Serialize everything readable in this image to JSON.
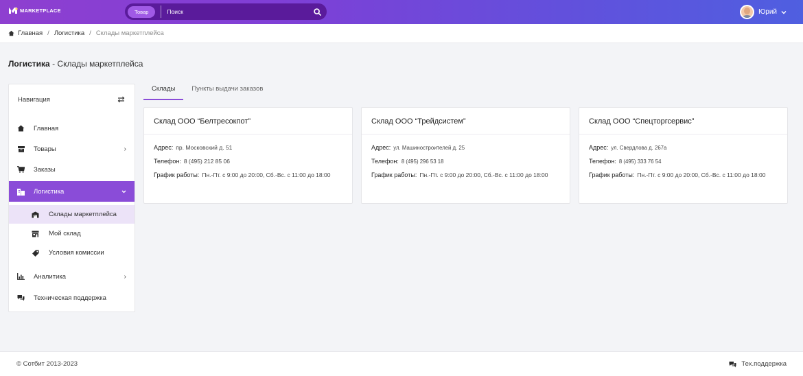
{
  "colors": {
    "accent": "#8a4cd8",
    "accent_light": "#ece3f8",
    "topbar_start": "#8e3fd0",
    "topbar_end": "#4f5fe0"
  },
  "header": {
    "logo_text": "MARKETPLACE",
    "search": {
      "category": "Товар",
      "placeholder": "Поиск"
    },
    "user_name": "Юрий"
  },
  "breadcrumb": {
    "home": "Главная",
    "section": "Логистика",
    "current": "Склады маркетплейса"
  },
  "page_title": {
    "section": "Логистика",
    "separator": " - ",
    "page": "Склады маркетплейса"
  },
  "sidebar": {
    "heading": "Навигация",
    "items": [
      {
        "label": "Главная",
        "icon": "home-icon"
      },
      {
        "label": "Товары",
        "icon": "box-icon"
      },
      {
        "label": "Заказы",
        "icon": "cart-icon"
      },
      {
        "label": "Логистика",
        "icon": "warehouse-icon"
      },
      {
        "label": "Аналитика",
        "icon": "chart-icon"
      },
      {
        "label": "Техническая поддержка",
        "icon": "support-icon"
      }
    ],
    "sub_items": [
      {
        "label": "Склады маркетплейса",
        "icon": "warehouse-icon"
      },
      {
        "label": "Мой склад",
        "icon": "store-icon"
      },
      {
        "label": "Условия комиссии",
        "icon": "tag-icon"
      }
    ]
  },
  "tabs": [
    "Склады",
    "Пункты выдачи заказов"
  ],
  "field_labels": {
    "address": "Адрес:",
    "phone": "Телефон:",
    "schedule": "График работы:"
  },
  "cards": [
    {
      "title": "Склад ООО “Белтресокпот”",
      "address": "пр. Московский д. 51",
      "phone": "8 (495) 212 85 06",
      "schedule": "Пн.-Пт. с 9:00 до 20:00, Сб.-Вс. с 11:00 до 18:00"
    },
    {
      "title": "Склад ООО “Трейдсистем”",
      "address": "ул. Машиностроителей д. 25",
      "phone": "8 (495)  296 53 18",
      "schedule": "Пн.-Пт. с 9:00 до 20:00, Сб.-Вс. с 11:00 до 18:00"
    },
    {
      "title": "Склад ООО “Спецторгсервис”",
      "address": "ул. Свердлова д. 267а",
      "phone": "8 (495)  333 76 54",
      "schedule": "Пн.-Пт. с 9:00 до 20:00, Сб.-Вс. с 11:00 до 18:00"
    }
  ],
  "footer": {
    "copyright": "© Сотбит 2013-2023",
    "support": "Тех.поддержка"
  }
}
